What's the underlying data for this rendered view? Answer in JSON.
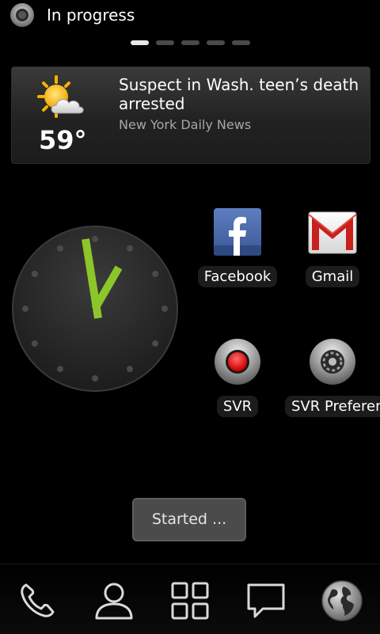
{
  "status_bar": {
    "icon": "record-indicator-icon",
    "text": "In progress"
  },
  "page_indicator": {
    "count": 5,
    "active_index": 0
  },
  "news_widget": {
    "weather_icon": "partly-cloudy-icon",
    "temperature": "59°",
    "headline": "Suspect in Wash. teen’s death arrested",
    "source": "New York Daily News"
  },
  "clock": {
    "icon": "analog-clock-icon",
    "hands_color": "#8cc62a"
  },
  "apps": [
    {
      "label": "Facebook",
      "icon": "facebook-icon"
    },
    {
      "label": "Gmail",
      "icon": "gmail-icon"
    },
    {
      "label": "SVR",
      "icon": "record-button-icon"
    },
    {
      "label": "SVR Preferences",
      "icon": "svr-preferences-icon"
    }
  ],
  "toast": {
    "text": "Started ..."
  },
  "dock": [
    {
      "icon": "phone-icon"
    },
    {
      "icon": "contacts-icon"
    },
    {
      "icon": "app-drawer-icon"
    },
    {
      "icon": "messaging-icon"
    },
    {
      "icon": "browser-globe-icon"
    }
  ]
}
